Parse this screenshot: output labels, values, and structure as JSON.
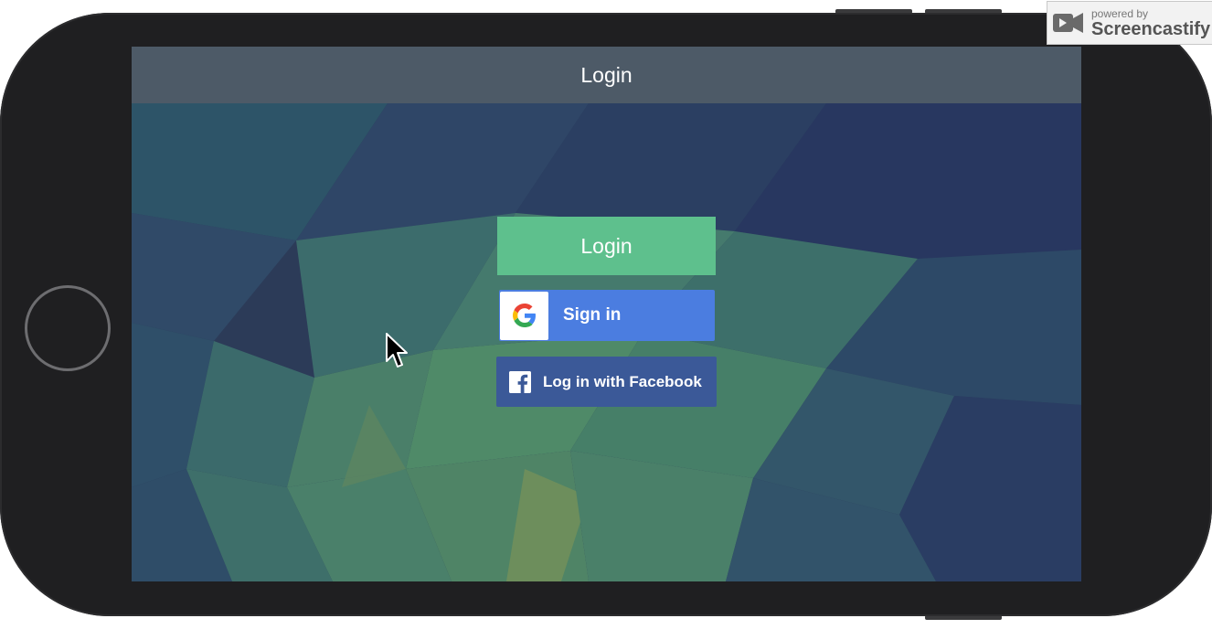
{
  "navbar": {
    "title": "Login"
  },
  "actions": {
    "login_label": "Login",
    "google_label": "Sign in",
    "facebook_label": "Log in with Facebook"
  },
  "watermark": {
    "line1": "powered by",
    "line2": "Screencastify"
  },
  "icons": {
    "google": "google-g-icon",
    "facebook": "facebook-f-icon",
    "cursor": "mouse-pointer-icon",
    "watermark": "screencastify-logo-icon"
  },
  "colors": {
    "login_button": "#5ec08d",
    "google_button": "#4b7de0",
    "facebook_button": "#3b5998",
    "navbar": "#4d5a67"
  }
}
